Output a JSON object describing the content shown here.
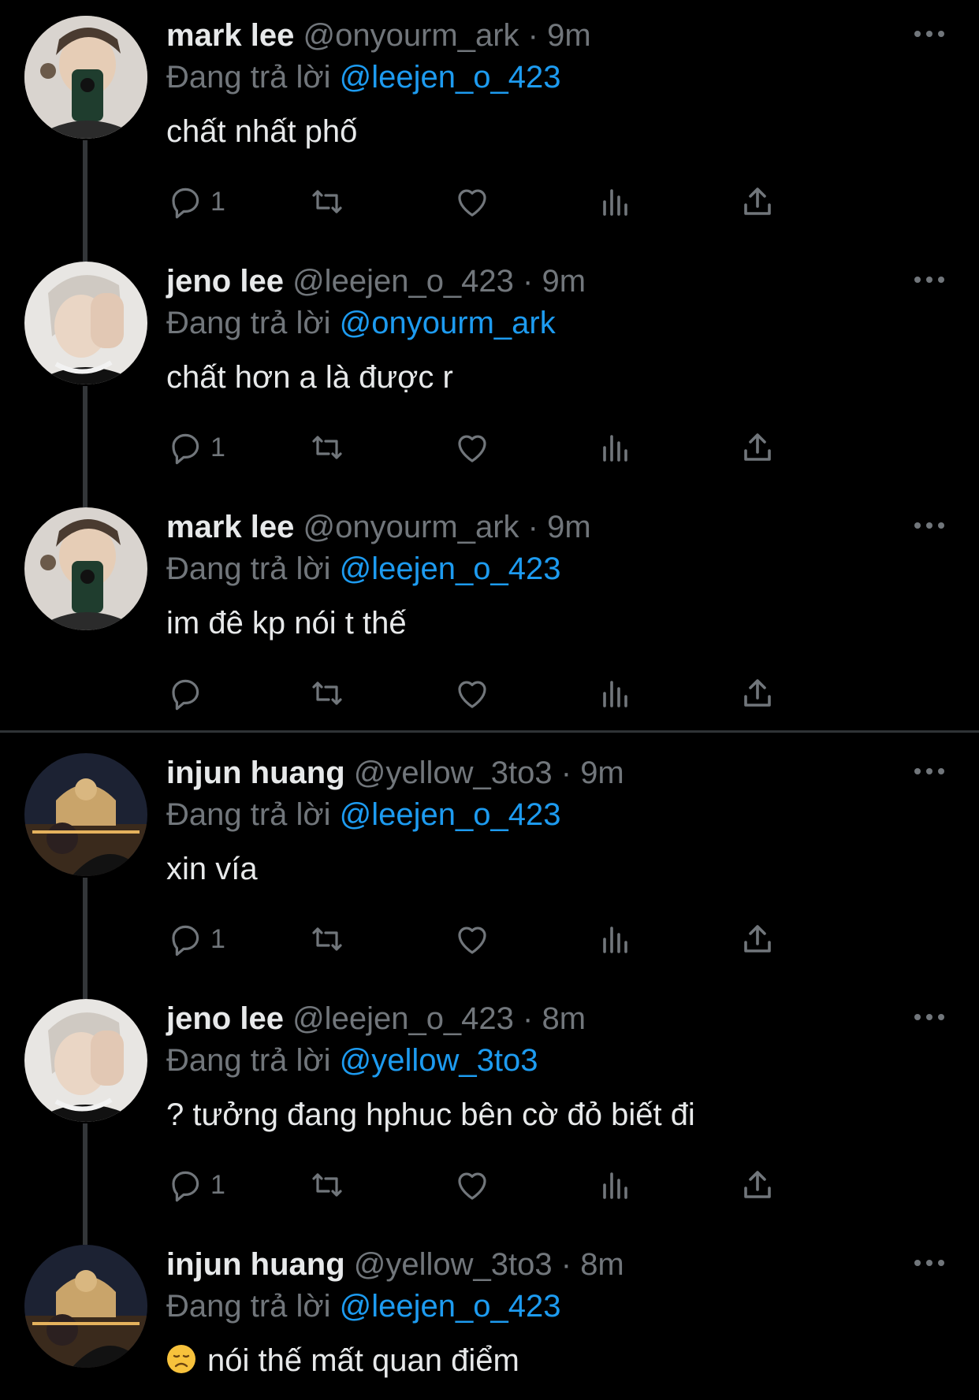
{
  "reply_prefix": "Đang trả lời",
  "tweets": [
    {
      "name": "mark lee",
      "handle": "@onyourm_ark",
      "dot": "·",
      "time": "9m",
      "reply_to": "@leejen_o_423",
      "text": "chất nhất phố",
      "reply_count": "1",
      "avatar": "mark-lee-avatar"
    },
    {
      "name": "jeno lee",
      "handle": "@leejen_o_423",
      "dot": "·",
      "time": "9m",
      "reply_to": "@onyourm_ark",
      "text": "chất hơn a là được r",
      "reply_count": "1",
      "avatar": "jeno-lee-avatar"
    },
    {
      "name": "mark lee",
      "handle": "@onyourm_ark",
      "dot": "·",
      "time": "9m",
      "reply_to": "@leejen_o_423",
      "text": "im đê kp nói t thế",
      "reply_count": "",
      "avatar": "mark-lee-avatar"
    },
    {
      "name": "injun huang",
      "handle": "@yellow_3to3",
      "dot": "·",
      "time": "9m",
      "reply_to": "@leejen_o_423",
      "text": "xin vía",
      "reply_count": "1",
      "avatar": "injun-huang-avatar"
    },
    {
      "name": "jeno lee",
      "handle": "@leejen_o_423",
      "dot": "·",
      "time": "8m",
      "reply_to": "@yellow_3to3",
      "text": "? tưởng đang hphuc bên cờ đỏ biết đi",
      "reply_count": "1",
      "avatar": "jeno-lee-avatar"
    },
    {
      "name": "injun huang",
      "handle": "@yellow_3to3",
      "dot": "·",
      "time": "8m",
      "reply_to": "@leejen_o_423",
      "text": "nói thế mất quan điểm",
      "emoji": "disappointed-face-emoji",
      "avatar": "injun-huang-avatar"
    }
  ],
  "colors": {
    "background": "#000000",
    "text": "#e7e9ea",
    "secondary": "#71767b",
    "link": "#1d9bf0",
    "thread_line": "#333639"
  }
}
